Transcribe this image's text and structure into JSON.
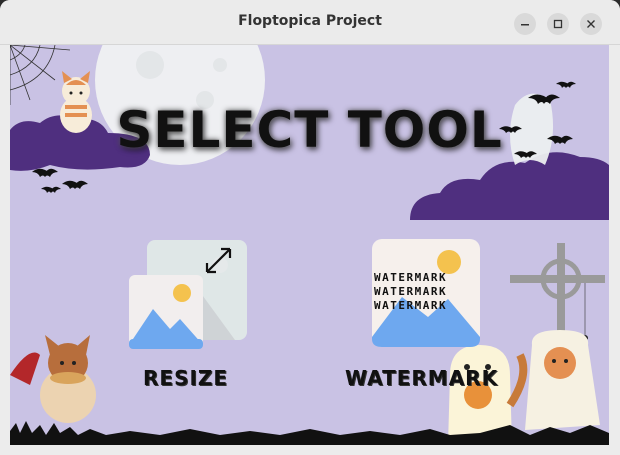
{
  "window": {
    "title": "Floptopica Project"
  },
  "header": {
    "title": "SELECT TOOL"
  },
  "tools": [
    {
      "label": "RESIZE"
    },
    {
      "label": "WATERMARK",
      "watermark_lines": [
        "WATERMARK",
        "WATERMARK",
        "WATERMARK"
      ]
    }
  ],
  "colors": {
    "background": "#c9c2e4",
    "cloud": "#4f2f7f",
    "moon": "#f3f4f2",
    "title_text": "#111111",
    "image_blue": "#6ea8ef",
    "sun": "#f4c24e"
  },
  "icons": {
    "minimize": "minimize-icon",
    "maximize": "maximize-icon",
    "close": "close-icon",
    "resize_arrow": "diagonal-resize-arrow-icon"
  }
}
